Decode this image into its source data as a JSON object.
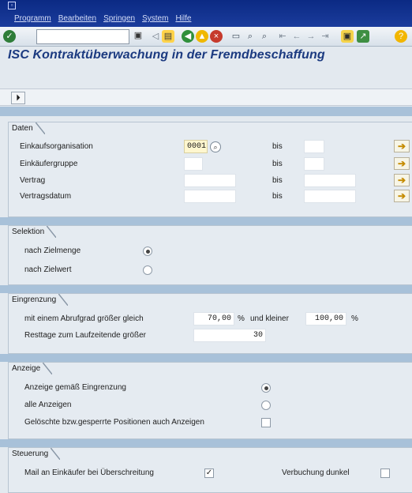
{
  "menu": [
    "Programm",
    "Bearbeiten",
    "Springen",
    "System",
    "Hilfe"
  ],
  "toolbar": {
    "command_value": "",
    "icons": [
      "check-icon",
      "save-icon",
      "back-icon",
      "exit-icon",
      "cancel-icon",
      "print-icon",
      "find-icon",
      "find-next-icon",
      "first-page-icon",
      "previous-page-icon",
      "next-page-icon",
      "last-page-icon",
      "new-session-icon",
      "shortcut-icon",
      "help-icon"
    ]
  },
  "title": "ISC Kontraktüberwachung in der Fremdbeschaffung",
  "sections": {
    "daten": {
      "title": "Daten",
      "rows": [
        {
          "label": "Einkaufsorganisation",
          "from": "0001",
          "to_label": "bis",
          "to": ""
        },
        {
          "label": "Einkäufergruppe",
          "from": "",
          "to_label": "bis",
          "to": ""
        },
        {
          "label": "Vertrag",
          "from": "",
          "to_label": "bis",
          "to": ""
        },
        {
          "label": "Vertragsdatum",
          "from": "",
          "to_label": "bis",
          "to": ""
        }
      ]
    },
    "selektion": {
      "title": "Selektion",
      "options": [
        {
          "label": "nach Zielmenge",
          "selected": true
        },
        {
          "label": "nach Zielwert",
          "selected": false
        }
      ]
    },
    "eingrenzung": {
      "title": "Eingrenzung",
      "row1_label": "mit einem Abrufgrad größer gleich",
      "min_value": "70,00",
      "unit1": "%",
      "and_label": "und kleiner",
      "max_value": "100,00",
      "unit2": "%",
      "row2_label": "Resttage zum Laufzeitende größer",
      "resttage": "30"
    },
    "anzeige": {
      "title": "Anzeige",
      "options": [
        {
          "label": "Anzeige gemäß Eingrenzung",
          "selected": true
        },
        {
          "label": "alle Anzeigen",
          "selected": false
        }
      ],
      "deleted_label": "Gelöschte bzw.gesperrte Positionen auch Anzeigen",
      "deleted_checked": false
    },
    "steuerung": {
      "title": "Steuerung",
      "mail_label": "Mail an Einkäufer bei Überschreitung",
      "mail_checked": true,
      "verbuchung_label": "Verbuchung dunkel",
      "verbuchung_checked": false
    }
  },
  "colors": {
    "accent": "#1b3a80",
    "titlebar": "#0b2a84",
    "required_field": "#fff7cf"
  }
}
